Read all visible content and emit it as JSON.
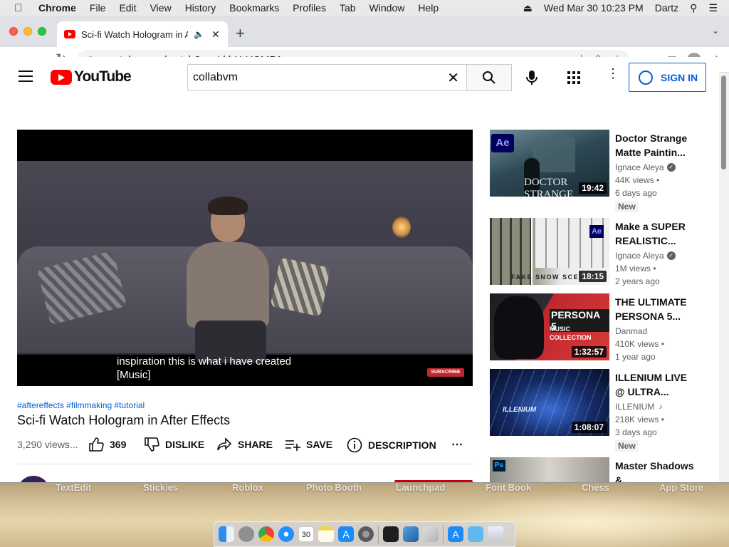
{
  "menubar": {
    "app_name": "Chrome",
    "menus": [
      "File",
      "Edit",
      "View",
      "History",
      "Bookmarks",
      "Profiles",
      "Tab",
      "Window",
      "Help"
    ],
    "clock": "Wed Mar 30  10:23 PM",
    "user": "Dartz"
  },
  "browser": {
    "tab_title": "Sci-fi Watch Hologram in After Effects - YouTube",
    "url": "youtube.com/watch?v=sLkhU-YCMPA"
  },
  "youtube": {
    "logo_text": "YouTube",
    "search_query": "collabvm",
    "signin_label": "SIGN IN"
  },
  "player": {
    "caption_line1": "inspiration this is what i have created",
    "caption_line2": "[Music]",
    "subscribe_badge": "SUBSCRIBE"
  },
  "video": {
    "hashtags": "#aftereffects #filmmaking #tutorial",
    "title": "Sci-fi Watch Hologram in After Effects",
    "views": "3,290 views...",
    "likes": "369",
    "dislike_label": "DISLIKE",
    "share_label": "SHARE",
    "save_label": "SAVE",
    "description_label": "DESCRIPTION"
  },
  "related": [
    {
      "title": "Doctor Strange Matte Paintin...",
      "channel": "Ignace Aleya",
      "verified": true,
      "views": "44K views",
      "age": "6 days ago",
      "new": "New",
      "duration": "19:42",
      "thumb_text": "DOCTOR STRANGE",
      "badge": "Ae"
    },
    {
      "title": "Make a SUPER REALISTIC...",
      "channel": "Ignace Aleya",
      "verified": true,
      "views": "1M views",
      "age": "2 years ago",
      "new": "",
      "duration": "18:15",
      "thumb_text": "FAKE SNOW SCE",
      "badge": "Ae"
    },
    {
      "title": "THE ULTIMATE PERSONA 5...",
      "channel": "Danmad",
      "verified": false,
      "views": "410K views",
      "age": "1 year ago",
      "new": "",
      "duration": "1:32:57",
      "thumb_text": "PERSONA 5",
      "thumb_sub": "MUSIC COLLECTION",
      "badge": ""
    },
    {
      "title": "ILLENIUM LIVE @ ULTRA...",
      "channel": "ILLENIUM",
      "verified": false,
      "music": true,
      "views": "218K views",
      "age": "3 days ago",
      "new": "New",
      "duration": "1:08:07",
      "thumb_text": "ILLENIUM",
      "badge": ""
    },
    {
      "title": "Master Shadows &...",
      "channel": "",
      "verified": false,
      "views": "",
      "age": "",
      "new": "",
      "duration": "",
      "thumb_text": "",
      "badge": "Ps"
    }
  ],
  "desktop": {
    "icon_labels": [
      "TextEdit",
      "Stickies",
      "Roblox",
      "Photo Booth",
      "Launchpad",
      "Font Book",
      "Chess",
      "App Store"
    ]
  },
  "dock": {
    "apps": [
      "finder-icon",
      "launchpad-icon",
      "chrome-icon",
      "safari-icon",
      "calendar-icon",
      "notes-icon",
      "app-store-icon",
      "system-preferences-icon",
      "terminal-icon",
      "migration-assistant-icon",
      "preview-icon",
      "app-store-icon",
      "downloads-folder-icon",
      "trash-icon"
    ],
    "calendar_day": "30"
  }
}
